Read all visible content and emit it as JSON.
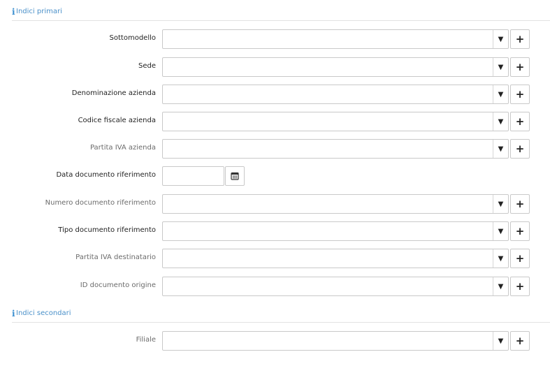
{
  "sections": {
    "primary": {
      "title": "Indici primari",
      "icon": "info-icon"
    },
    "secondary": {
      "title": "Indici secondari",
      "icon": "info-icon"
    }
  },
  "controls": {
    "dropdown_glyph": "▼",
    "add_glyph": "+"
  },
  "fields": {
    "sottomodello": {
      "label": "Sottomodello",
      "value": ""
    },
    "sede": {
      "label": "Sede",
      "value": ""
    },
    "denominazione_azienda": {
      "label": "Denominazione azienda",
      "value": ""
    },
    "codice_fiscale_azienda": {
      "label": "Codice fiscale azienda",
      "value": ""
    },
    "partita_iva_azienda": {
      "label": "Partita IVA azienda",
      "value": ""
    },
    "data_documento_riferimento": {
      "label": "Data documento riferimento",
      "value": ""
    },
    "numero_documento_riferimento": {
      "label": "Numero documento riferimento",
      "value": ""
    },
    "tipo_documento_riferimento": {
      "label": "Tipo documento riferimento",
      "value": ""
    },
    "partita_iva_destinatario": {
      "label": "Partita IVA destinatario",
      "value": ""
    },
    "id_documento_origine": {
      "label": "ID documento origine",
      "value": ""
    },
    "filiale": {
      "label": "Filiale",
      "value": ""
    }
  }
}
